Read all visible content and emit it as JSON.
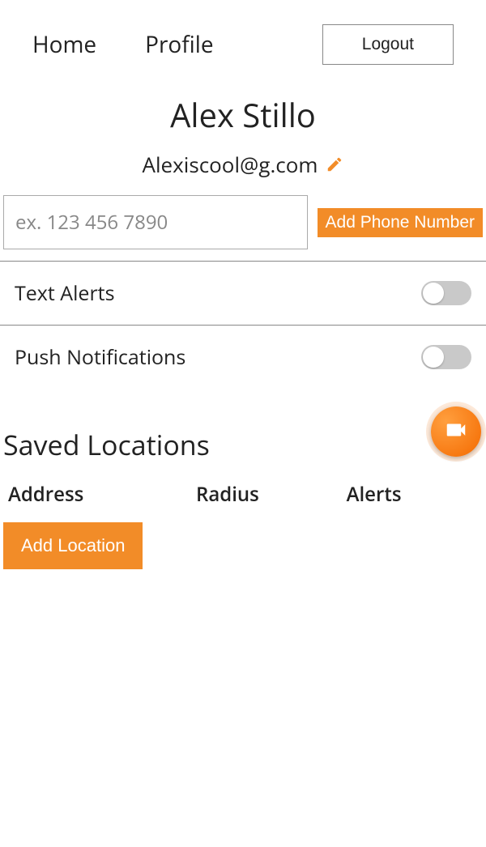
{
  "nav": {
    "home": "Home",
    "profile": "Profile",
    "logout": "Logout"
  },
  "user": {
    "name": "Alex Stillo",
    "email": "Alexiscool@g.com"
  },
  "phone": {
    "placeholder": "ex. 123 456 7890",
    "add_label": "Add Phone Number"
  },
  "settings": {
    "text_alerts_label": "Text Alerts",
    "push_notifications_label": "Push Notifications",
    "text_alerts_on": false,
    "push_notifications_on": false
  },
  "locations": {
    "title": "Saved Locations",
    "columns": {
      "address": "Address",
      "radius": "Radius",
      "alerts": "Alerts"
    },
    "add_label": "Add Location"
  },
  "colors": {
    "accent": "#f28c28"
  }
}
